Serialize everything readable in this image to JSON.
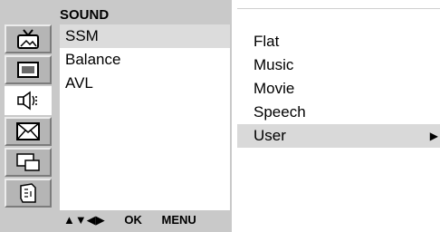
{
  "panel": {
    "title": "SOUND",
    "menu_items": [
      "SSM",
      "Balance",
      "AVL"
    ],
    "selected_menu_item": "SSM"
  },
  "icons": [
    {
      "name": "tv-picture-icon",
      "active": false
    },
    {
      "name": "screen-icon",
      "active": false
    },
    {
      "name": "speaker-sound-icon",
      "active": true
    },
    {
      "name": "time-envelope-icon",
      "active": false
    },
    {
      "name": "special-pip-icon",
      "active": false
    },
    {
      "name": "setup-card-icon",
      "active": false
    }
  ],
  "nav_hint": {
    "arrows": "▲▼◀▶",
    "ok": "OK",
    "menu": "MENU"
  },
  "options": {
    "items": [
      "Flat",
      "Music",
      "Movie",
      "Speech",
      "User"
    ],
    "selected": "User",
    "submenu_arrow": "▶"
  },
  "colors": {
    "panel_bg": "#c9c9c9",
    "highlight": "#dcdcdc"
  }
}
